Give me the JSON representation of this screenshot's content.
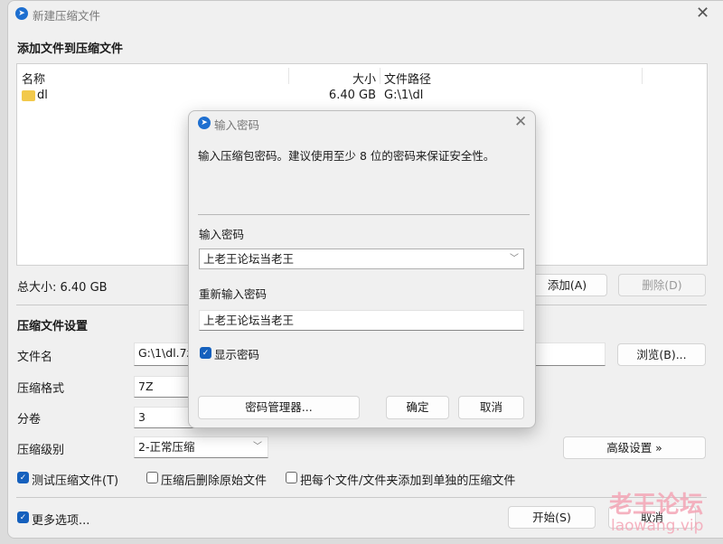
{
  "main": {
    "title": "新建压缩文件",
    "heading": "添加文件到压缩文件",
    "columns": [
      "名称",
      "大小",
      "文件路径"
    ],
    "rows": [
      {
        "name": "dl",
        "size": "6.40 GB",
        "path": "G:\\1\\dl"
      }
    ],
    "total": "总大小: 6.40 GB",
    "add": "添加(A)",
    "delete": "删除(D)",
    "settings_heading": "压缩文件设置",
    "filename_label": "文件名",
    "filename_value": "G:\\1\\dl.7z",
    "browse": "浏览(B)...",
    "format_label": "压缩格式",
    "format_value": "7Z",
    "volume_label": "分卷",
    "volume_value": "3",
    "level_label": "压缩级别",
    "level_value": "2-正常压缩",
    "advanced": "高级设置 »",
    "test": "测试压缩文件(T)",
    "delete_after": "压缩后删除原始文件",
    "separate": "把每个文件/文件夹添加到单独的压缩文件",
    "more": "更多选项...",
    "start": "开始(S)",
    "cancel": "取消"
  },
  "dialog": {
    "title": "输入密码",
    "message": "输入压缩包密码。建议使用至少 8 位的密码来保证安全性。",
    "password_label": "输入密码",
    "password_value": "上老王论坛当老王",
    "reenter_label": "重新输入密码",
    "reenter_value": "上老王论坛当老王",
    "show": "显示密码",
    "manager": "密码管理器...",
    "ok": "确定",
    "cancel": "取消"
  },
  "watermark": {
    "cn": "老王论坛",
    "en": "laowang.vip"
  }
}
